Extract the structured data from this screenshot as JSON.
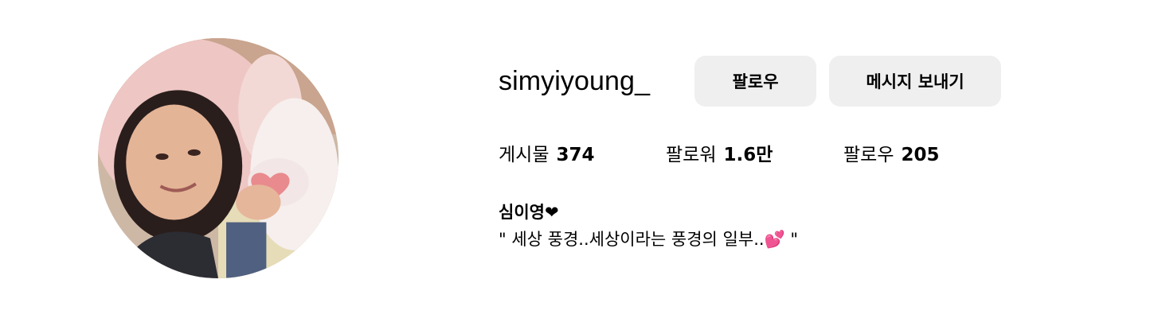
{
  "profile": {
    "username": "simyiyoung_",
    "display_name": "심이영❤",
    "bio": "\" 세상 풍경..세상이라는 풍경의 일부..💕 \"",
    "avatar_icon": "profile-photo"
  },
  "actions": {
    "follow_label": "팔로우",
    "message_label": "메시지 보내기"
  },
  "stats": {
    "posts_label": "게시물",
    "posts_value": "374",
    "followers_label": "팔로워",
    "followers_value": "1.6만",
    "following_label": "팔로우",
    "following_value": "205"
  },
  "colors": {
    "button_bg": "#efefef",
    "text": "#000000",
    "background": "#ffffff"
  }
}
